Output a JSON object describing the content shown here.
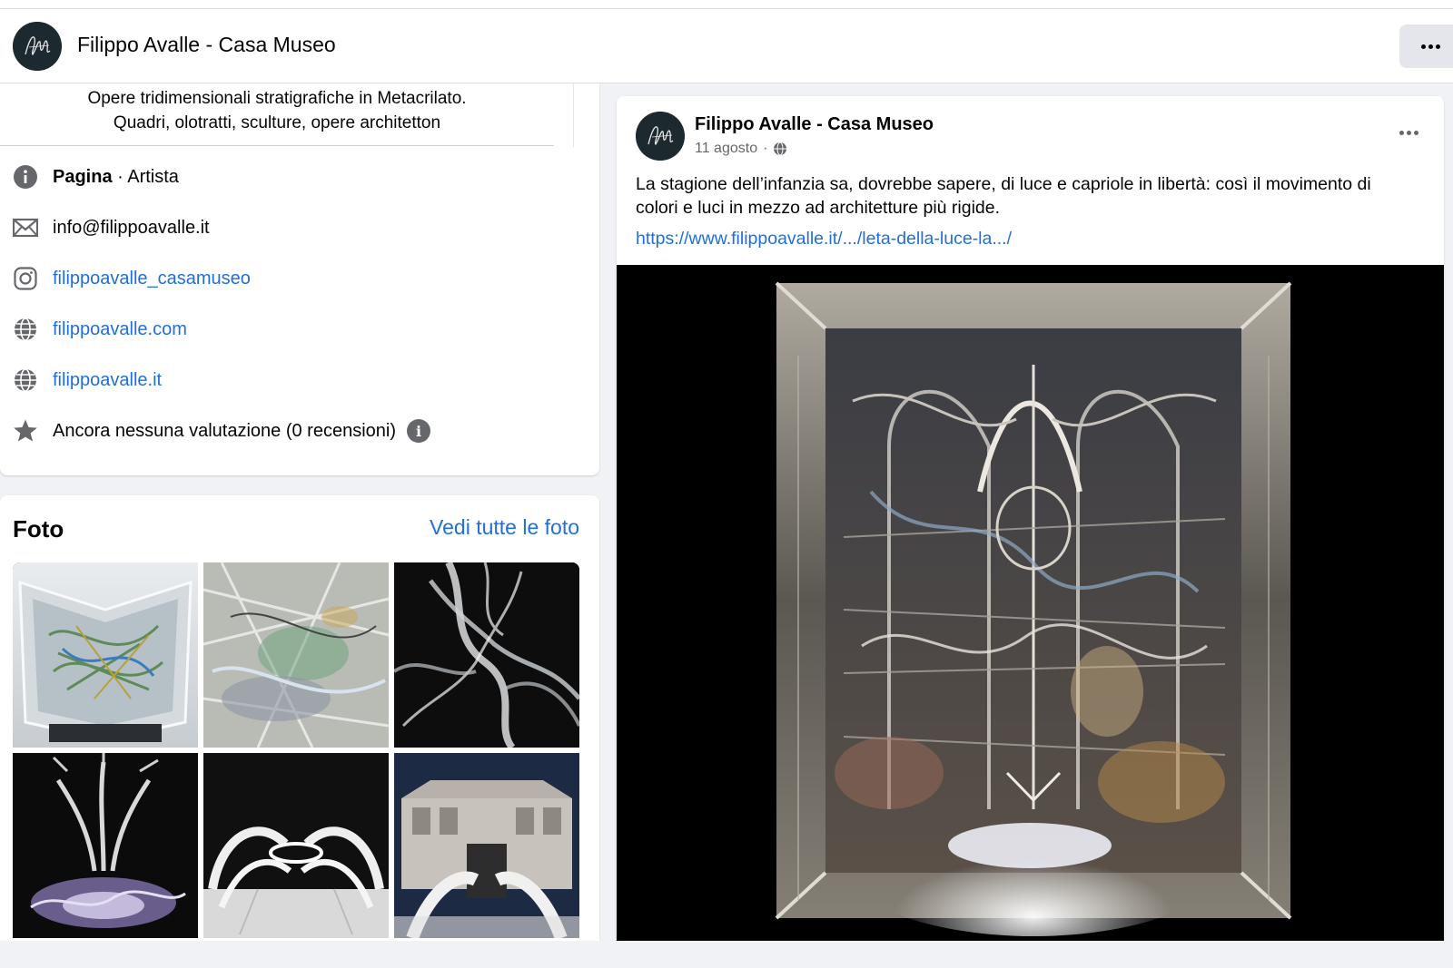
{
  "header": {
    "page_name": "Filippo Avalle - Casa Museo"
  },
  "intro": {
    "bio_line1": "Opere tridimensionali stratigrafiche in Metacrilato.",
    "bio_line2": "Quadri, olotratti, sculture, opere architetton",
    "category_label": "Pagina",
    "category_value": " · Artista",
    "email": "info@filippoavalle.it",
    "instagram": "filippoavalle_casamuseo",
    "website1": "filippoavalle.com",
    "website2": "filippoavalle.it",
    "rating": "Ancora nessuna valutazione (0 recensioni)",
    "icons": [
      "info-icon",
      "mail-icon",
      "instagram-icon",
      "globe-icon",
      "globe-icon",
      "star-icon"
    ]
  },
  "photos": {
    "title": "Foto",
    "see_all": "Vedi tutte le foto",
    "count": 6
  },
  "post": {
    "author": "Filippo Avalle - Casa Museo",
    "date": "11 agosto",
    "separator": "·",
    "text": "La stagione dell’infanzia sa, dovrebbe sapere, di luce e capriole in libertà: così il movimento di colori e luci in mezzo ad architetture più rigide.",
    "link": "https://www.filippoavalle.it/.../leta-della-luce-la.../"
  },
  "colors": {
    "link": "#216fdb",
    "secondary_text": "#65676b",
    "background": "#f0f2f5"
  }
}
